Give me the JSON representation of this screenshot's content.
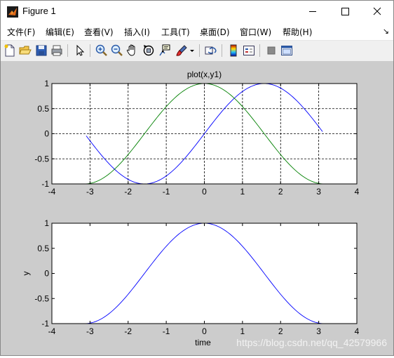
{
  "window": {
    "title": "Figure 1"
  },
  "menu": [
    "文件(F)",
    "编辑(E)",
    "查看(V)",
    "插入(I)",
    "工具(T)",
    "桌面(D)",
    "窗口(W)",
    "帮助(H)"
  ],
  "toolbar": {
    "icons": [
      "new-figure-icon",
      "open-icon",
      "save-icon",
      "print-icon",
      "edit-plot-arrow-icon",
      "zoom-in-icon",
      "zoom-out-icon",
      "pan-hand-icon",
      "rotate-3d-icon",
      "data-cursor-icon",
      "brush-icon",
      "brush-dropdown-icon",
      "link-plot-icon",
      "colorbar-icon",
      "legend-icon",
      "hide-plot-tools-icon",
      "show-plot-tools-icon"
    ]
  },
  "watermark": "https://blog.csdn.net/qq_42579966",
  "chart_data": [
    {
      "type": "line",
      "title": "plot(x,y1)",
      "xlabel": "",
      "ylabel": "",
      "xlim": [
        -4,
        4
      ],
      "ylim": [
        -1,
        1
      ],
      "xticks": [
        "-4",
        "-3",
        "-2",
        "-1",
        "0",
        "1",
        "2",
        "3",
        "4"
      ],
      "yticks": [
        "1",
        "0.5",
        "0",
        "-0.5",
        "-1"
      ],
      "grid": true,
      "series": [
        {
          "function": "sin",
          "x_range": [
            -3.1,
            3.1
          ],
          "color": "#0000ff"
        },
        {
          "function": "cos",
          "x_range": [
            -3.1,
            3.1
          ],
          "color": "#008000"
        }
      ]
    },
    {
      "type": "line",
      "title": "",
      "xlabel": "time",
      "ylabel": "y",
      "xlim": [
        -4,
        4
      ],
      "ylim": [
        -1,
        1
      ],
      "xticks": [
        "-4",
        "-3",
        "-2",
        "-1",
        "0",
        "1",
        "2",
        "3",
        "4"
      ],
      "yticks": [
        "1",
        "0.5",
        "0",
        "-0.5",
        "-1"
      ],
      "grid": false,
      "series": [
        {
          "function": "cos",
          "x_range": [
            -3.1,
            3.1
          ],
          "color": "#0000ff"
        }
      ]
    }
  ]
}
